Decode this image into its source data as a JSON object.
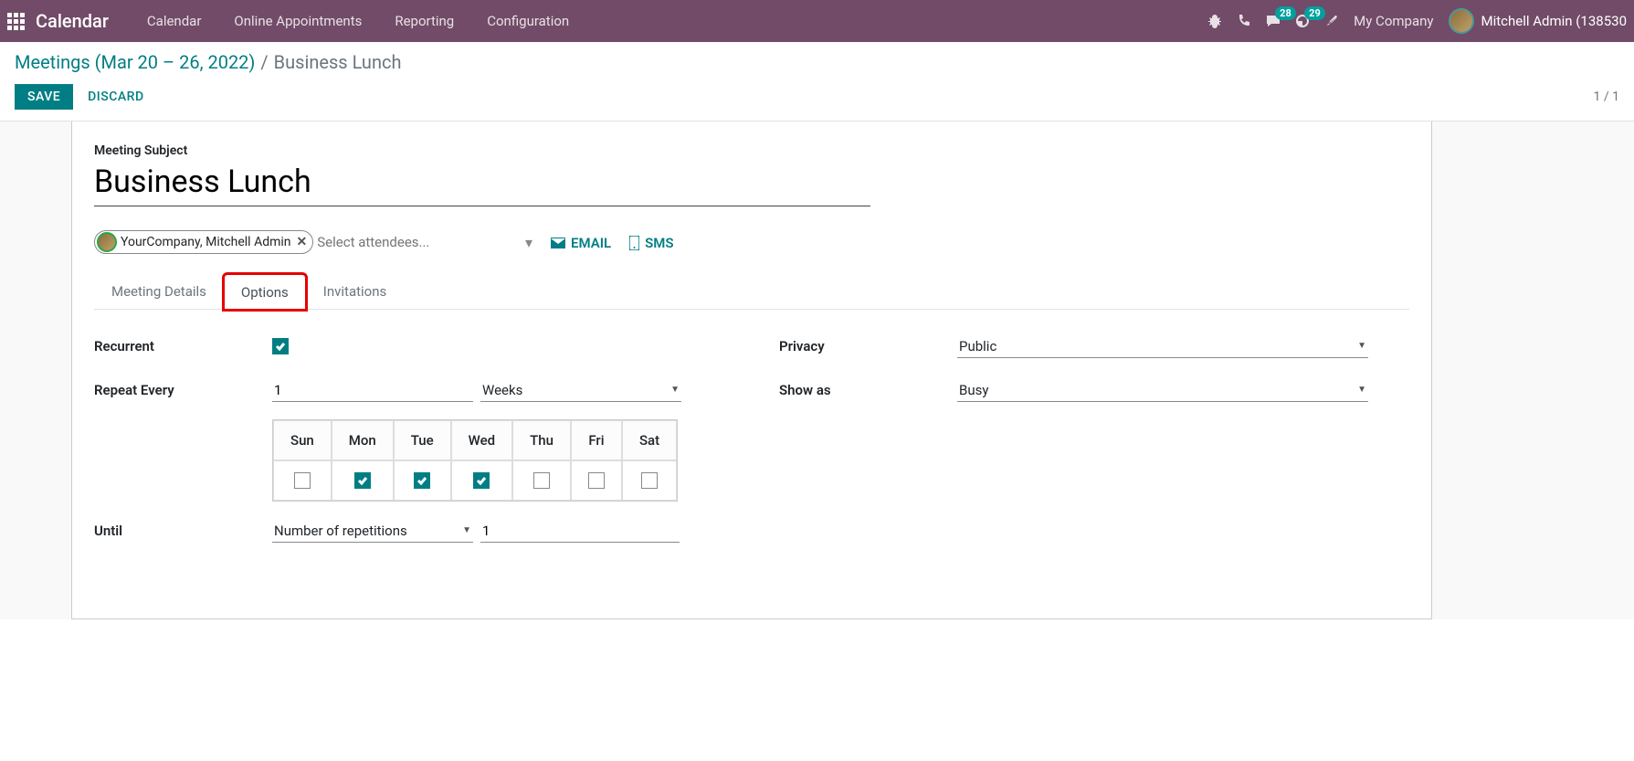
{
  "nav": {
    "brand": "Calendar",
    "items": [
      "Calendar",
      "Online Appointments",
      "Reporting",
      "Configuration"
    ],
    "messages_badge": "28",
    "activity_badge": "29",
    "company": "My Company",
    "user_name": "Mitchell Admin (138530"
  },
  "breadcrumb": {
    "parent": "Meetings (Mar 20 – 26, 2022)",
    "current": "Business Lunch"
  },
  "buttons": {
    "save": "SAVE",
    "discard": "DISCARD"
  },
  "pager": "1 / 1",
  "form": {
    "subject_label": "Meeting Subject",
    "subject_value": "Business Lunch",
    "attendee_tag": "YourCompany, Mitchell Admin",
    "attendee_placeholder": "Select attendees...",
    "email_action": "EMAIL",
    "sms_action": "SMS"
  },
  "tabs": {
    "details": "Meeting Details",
    "options": "Options",
    "invitations": "Invitations"
  },
  "options": {
    "recurrent_label": "Recurrent",
    "repeat_label": "Repeat Every",
    "repeat_value": "1",
    "repeat_unit": "Weeks",
    "days": [
      {
        "label": "Sun",
        "checked": false
      },
      {
        "label": "Mon",
        "checked": true
      },
      {
        "label": "Tue",
        "checked": true
      },
      {
        "label": "Wed",
        "checked": true
      },
      {
        "label": "Thu",
        "checked": false
      },
      {
        "label": "Fri",
        "checked": false
      },
      {
        "label": "Sat",
        "checked": false
      }
    ],
    "until_label": "Until",
    "until_mode": "Number of repetitions",
    "until_count": "1",
    "privacy_label": "Privacy",
    "privacy_value": "Public",
    "showas_label": "Show as",
    "showas_value": "Busy"
  }
}
